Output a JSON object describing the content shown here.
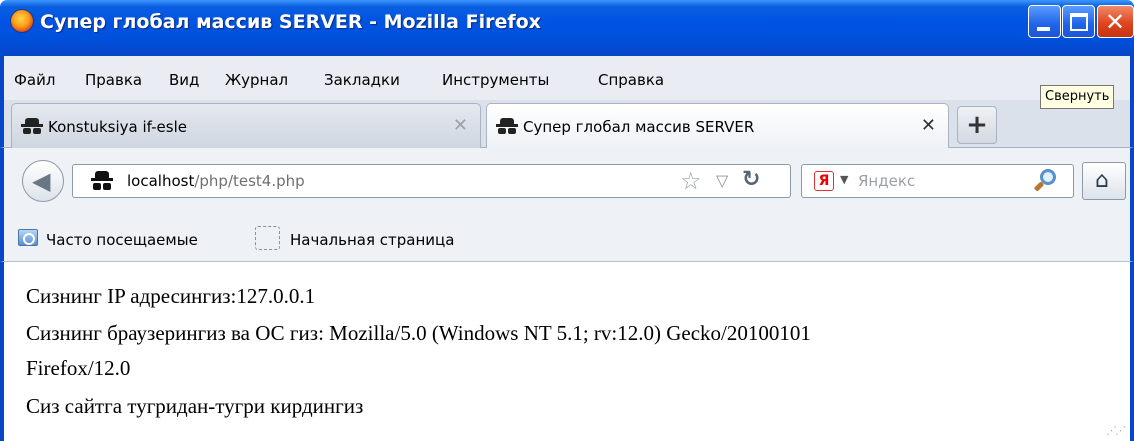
{
  "window": {
    "title": "Супер глобал массив SERVER - Mozilla Firefox",
    "tooltip": "Свернуть"
  },
  "menu": [
    "Файл",
    "Правка",
    "Вид",
    "Журнал",
    "Закладки",
    "Инструменты",
    "Справка"
  ],
  "tabs": [
    {
      "label": "Konstuksiya if-esle",
      "active": false
    },
    {
      "label": "Супер глобал массив SERVER",
      "active": true
    }
  ],
  "navbar": {
    "url_host": "localhost",
    "url_path": "/php/test4.php",
    "search_placeholder": "Яндекс",
    "search_engine_icon": "Я"
  },
  "bookmarks": [
    "Часто посещаемые",
    "Начальная страница"
  ],
  "content": {
    "lines": [
      "Сизнинг IP адресингиз:127.0.0.1",
      "Сизнинг браузерингиз ва ОС гиз: Mozilla/5.0 (Windows NT 5.1; rv:12.0) Gecko/20100101",
      "Firefox/12.0",
      "Сиз сайтга тугридан-тугри кирдингиз"
    ]
  },
  "colors": {
    "titlebar": "#0054e3",
    "chrome_background": "#eef1f5",
    "tooltip_background": "#ffffe1"
  }
}
